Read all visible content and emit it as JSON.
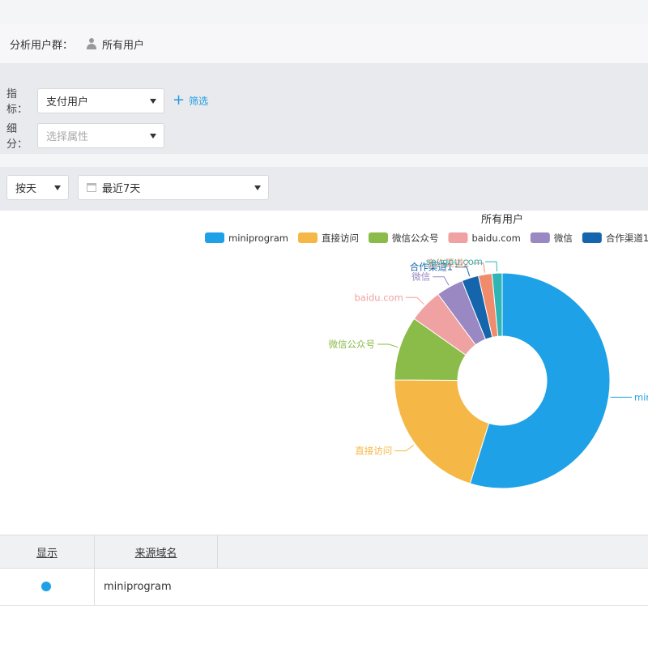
{
  "header": {
    "usergroup_label": "分析用户群：",
    "usergroup_value": "所有用户"
  },
  "filters": {
    "metric_label": "指标：",
    "metric_value": "支付用户",
    "add_filter_label": "筛选",
    "breakdown_label": "细分：",
    "breakdown_placeholder": "选择属性"
  },
  "date": {
    "granularity": "按天",
    "range": "最近7天"
  },
  "chart_data": {
    "type": "pie",
    "title": "所有用户",
    "legend_position": "top-right",
    "slices": [
      {
        "name": "miniprogram",
        "value": 54.0,
        "color": "#1ea1e6",
        "label": "mini"
      },
      {
        "name": "直接访问",
        "value": 20.0,
        "color": "#f5b846",
        "label": "直接访问"
      },
      {
        "name": "微信公众号",
        "value": 9.5,
        "color": "#8bbb48",
        "label": "微信公众号"
      },
      {
        "name": "baidu.com",
        "value": 5.0,
        "color": "#f0a1a2",
        "label": "baidu.com"
      },
      {
        "name": "微信",
        "value": 4.0,
        "color": "#9a88c3",
        "label": "微信"
      },
      {
        "name": "合作渠道1",
        "value": 2.5,
        "color": "#1465ab",
        "label": "合作渠道1"
      },
      {
        "name": "合作渠道2",
        "value": 2.0,
        "color": "#f08b6c",
        "label": "合作渠道2"
      },
      {
        "name": "sougou.com",
        "value": 1.5,
        "color": "#2fb5b5",
        "label": "sougou.com"
      }
    ],
    "legend_visible": [
      "miniprogram",
      "直接访问",
      "微信公众号",
      "baidu.com",
      "微信",
      "合作渠道1"
    ]
  },
  "table": {
    "headers": [
      "显示",
      "来源域名"
    ],
    "rows": [
      {
        "visible": true,
        "name": "miniprogram",
        "color": "#1ea1e6"
      }
    ]
  }
}
